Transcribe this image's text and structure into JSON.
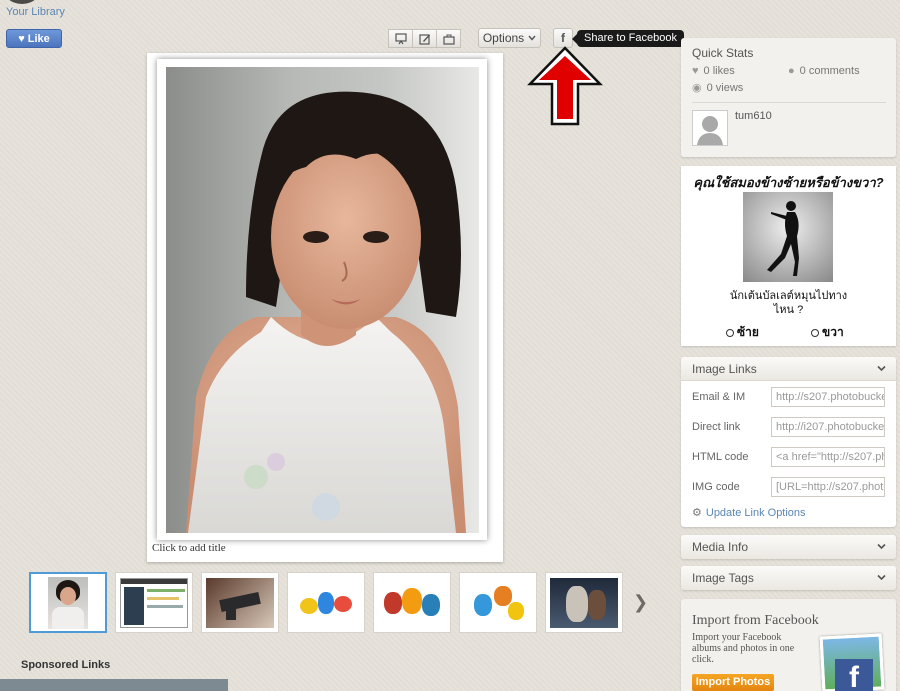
{
  "header": {
    "your_library": "Your Library",
    "like_label": "Like"
  },
  "toolbar": {
    "options_label": "Options",
    "facebook_glyph": "f",
    "facebook_tooltip": "Share to Facebook",
    "tools": [
      "slideshow-icon",
      "edit-icon",
      "briefcase-icon"
    ]
  },
  "photo": {
    "add_title": "Click to add title"
  },
  "thumbnails": {
    "count": 7,
    "active_index": 0
  },
  "sponsored_label": "Sponsored Links",
  "quick_stats": {
    "title": "Quick Stats",
    "likes": "0 likes",
    "comments": "0 comments",
    "views": "0 views",
    "username": "tum610"
  },
  "ad": {
    "title": "คุณใช้สมองข้างซ้ายหรือข้างขวา?",
    "question": "นักเต้นบัลเลต์หมุนไปทางไหน ?",
    "option_left": "ซ้าย",
    "option_right": "ขวา"
  },
  "image_links": {
    "title": "Image Links",
    "rows": [
      {
        "label": "Email & IM",
        "value": "http://s207.photobucket"
      },
      {
        "label": "Direct link",
        "value": "http://i207.photobucket"
      },
      {
        "label": "HTML code",
        "value": "<a href=\"http://s207.ph"
      },
      {
        "label": "IMG code",
        "value": "[URL=http://s207.photo"
      }
    ],
    "update_label": "Update Link Options"
  },
  "media_info": {
    "title": "Media Info"
  },
  "image_tags": {
    "title": "Image Tags"
  },
  "import_facebook": {
    "title": "Import from Facebook",
    "description": "Import your Facebook albums and photos in one click.",
    "button_label": "Import Photos",
    "logo_glyph": "f"
  },
  "colors": {
    "accent_blue": "#4e9bd7",
    "link_blue": "#5b86b3",
    "arrow_red": "#e00000",
    "import_orange": "#f5a623",
    "facebook_blue": "#3b5998"
  }
}
